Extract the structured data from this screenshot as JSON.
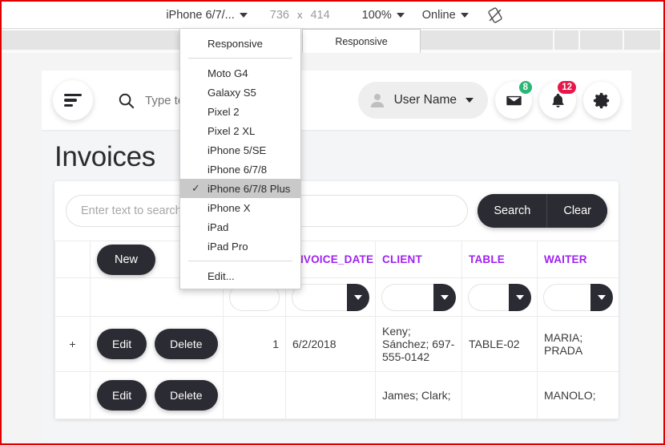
{
  "devtools_bar": {
    "device_select": "iPhone 6/7/...",
    "width": "736",
    "times": "x",
    "height": "414",
    "zoom": "100%",
    "throttle": "Online",
    "rotate_icon": "rotate-device-icon"
  },
  "ruler": {
    "active_label": "Responsive"
  },
  "device_dropdown": {
    "responsive": "Responsive",
    "items": [
      {
        "label": "Moto G4",
        "checked": false
      },
      {
        "label": "Galaxy S5",
        "checked": false
      },
      {
        "label": "Pixel 2",
        "checked": false
      },
      {
        "label": "Pixel 2 XL",
        "checked": false
      },
      {
        "label": "iPhone 5/SE",
        "checked": false
      },
      {
        "label": "iPhone 6/7/8",
        "checked": false
      },
      {
        "label": "iPhone 6/7/8 Plus",
        "checked": true
      },
      {
        "label": "iPhone X",
        "checked": false
      },
      {
        "label": "iPad",
        "checked": false
      },
      {
        "label": "iPad Pro",
        "checked": false
      }
    ],
    "edit": "Edit..."
  },
  "app_header": {
    "menu_icon": "hamburger-menu-icon",
    "search_icon": "search-icon",
    "search_placeholder": "Type to search...",
    "search_value": "",
    "user_name": "User Name",
    "avatar_icon": "user-avatar-icon",
    "mail_icon": "envelope-icon",
    "mail_badge": "8",
    "mail_badge_color": "#2bb673",
    "bell_icon": "bell-icon",
    "bell_badge": "12",
    "bell_badge_color": "#e8174a",
    "settings_icon": "gear-icon"
  },
  "page": {
    "title": "Invoices",
    "accent_color": "#a020f0"
  },
  "search_panel": {
    "placeholder": "Enter text to search...",
    "value": "",
    "search_label": "Search",
    "clear_label": "Clear"
  },
  "grid": {
    "new_label": "New",
    "edit_label": "Edit",
    "delete_label": "Delete",
    "expand_icon": "plus-expand-icon",
    "columns": [
      {
        "key": "expand",
        "label": ""
      },
      {
        "key": "actions",
        "label": ""
      },
      {
        "key": "id",
        "label": ""
      },
      {
        "key": "invoice_date",
        "label": "INVOICE_DATE"
      },
      {
        "key": "client",
        "label": "CLIENT"
      },
      {
        "key": "table",
        "label": "TABLE"
      },
      {
        "key": "waiter",
        "label": "WAITER"
      }
    ],
    "filters": [
      {
        "key": "id",
        "value": "",
        "has_dropdown": false
      },
      {
        "key": "invoice_date",
        "value": "",
        "has_dropdown": true
      },
      {
        "key": "client",
        "value": "",
        "has_dropdown": true
      },
      {
        "key": "table",
        "value": "",
        "has_dropdown": true
      },
      {
        "key": "waiter",
        "value": "",
        "has_dropdown": true
      }
    ],
    "rows": [
      {
        "id": "1",
        "invoice_date": "6/2/2018",
        "client": "Keny; Sánchez; 697-555-0142",
        "table": "TABLE-02",
        "waiter": "MARIA; PRADA"
      },
      {
        "id": "",
        "invoice_date": "",
        "client": "James; Clark;",
        "table": "",
        "waiter": "MANOLO;"
      }
    ]
  }
}
